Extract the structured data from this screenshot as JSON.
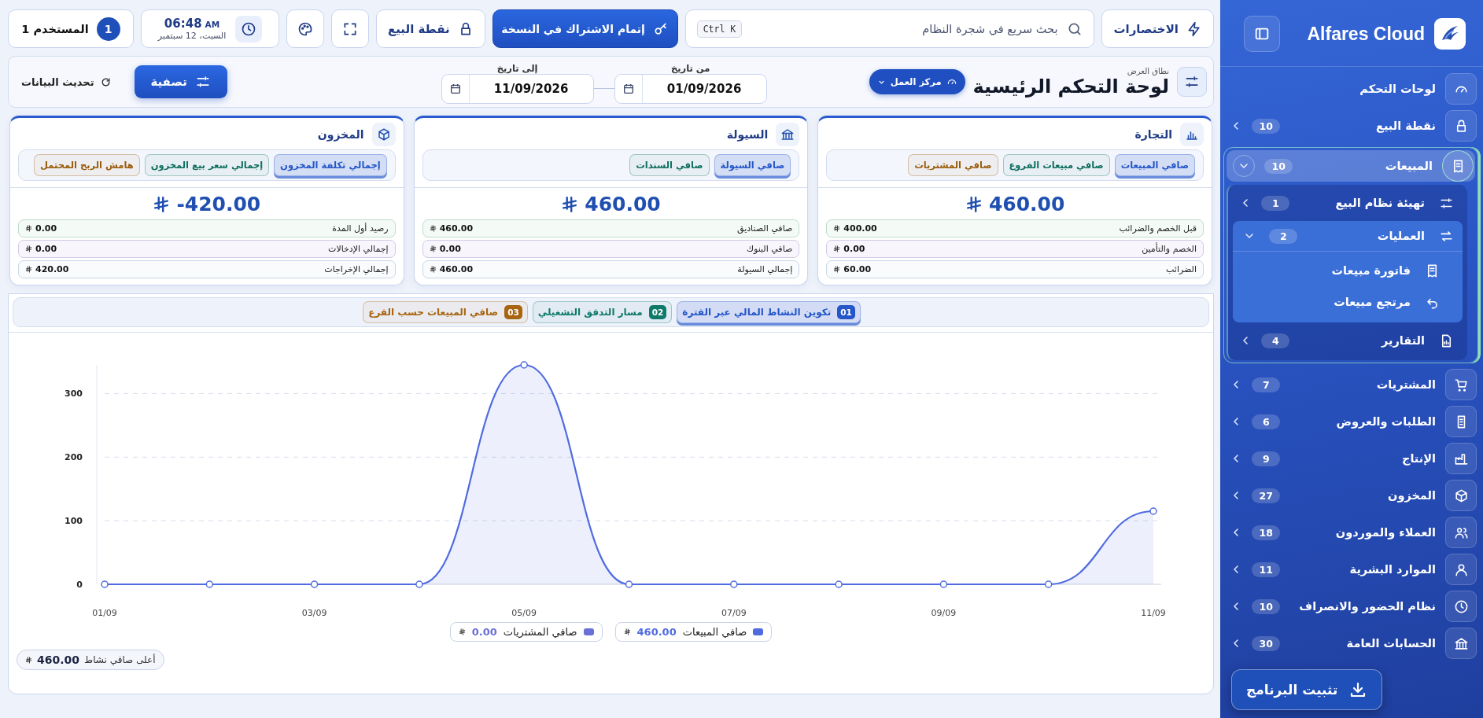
{
  "topbar": {
    "shortcuts": "الاختصارات",
    "search": {
      "placeholder": "بحث سريع في شجرة النظام",
      "shortcut": "Ctrl K"
    },
    "subscribe": "إتمام الاشتراك في النسخة",
    "pos": "نقطة البيع",
    "clock": {
      "time": "06:48",
      "meridiem": "AM",
      "date": "السبت، 12 سبتمبر"
    },
    "user": {
      "name": "المستخدم 1",
      "badge": "1"
    }
  },
  "header": {
    "caption": "نطاق العرض",
    "title": "لوحة التحكم الرئيسية",
    "scope": "مركز العمل",
    "from": {
      "label": "من تاريخ",
      "value": "01/09/2026"
    },
    "to": {
      "label": "إلى تاريخ",
      "value": "11/09/2026"
    },
    "filter": "تصفية",
    "refresh": "تحديث البيانات"
  },
  "cards": [
    {
      "title": "التجارة",
      "tabs": [
        {
          "label": "صافي المبيعات",
          "selected": true,
          "color": "#2456c9"
        },
        {
          "label": "صافي مبيعات الفروع",
          "selected": false,
          "color": "#0f6e5f"
        },
        {
          "label": "صافي المشتريات",
          "selected": false,
          "color": "#9a5c0c"
        }
      ],
      "total": "460.00",
      "rows": [
        {
          "label": "قبل الخصم والضرائب",
          "value": "400.00"
        },
        {
          "label": "الخصم والتأمين",
          "value": "0.00"
        },
        {
          "label": "الضرائب",
          "value": "60.00"
        }
      ]
    },
    {
      "title": "السيولة",
      "tabs": [
        {
          "label": "صافي السيولة",
          "selected": true,
          "color": "#2456c9"
        },
        {
          "label": "صافي السندات",
          "selected": false,
          "color": "#0f6e5f"
        }
      ],
      "total": "460.00",
      "rows": [
        {
          "label": "صافي الصناديق",
          "value": "460.00"
        },
        {
          "label": "صافي البنوك",
          "value": "0.00"
        },
        {
          "label": "إجمالي السيولة",
          "value": "460.00"
        }
      ]
    },
    {
      "title": "المخزون",
      "tabs": [
        {
          "label": "إجمالي تكلفة المخزون",
          "selected": true,
          "color": "#2456c9"
        },
        {
          "label": "إجمالي سعر بيع المخزون",
          "selected": false,
          "color": "#0f6e5f"
        },
        {
          "label": "هامش الربح المحتمل",
          "selected": false,
          "color": "#9a5c0c"
        }
      ],
      "total": "-420.00",
      "rows": [
        {
          "label": "رصيد أول المدة",
          "value": "0.00"
        },
        {
          "label": "إجمالي الإدخالات",
          "value": "0.00"
        },
        {
          "label": "إجمالي الإخراجات",
          "value": "420.00"
        }
      ]
    }
  ],
  "chart_panel": {
    "tabs": [
      {
        "number": "01",
        "label": "تكوين النشاط المالي عبر الفترة",
        "selected": true,
        "color": "#2456c9"
      },
      {
        "number": "02",
        "label": "مسار التدفق التشغيلي",
        "selected": false,
        "color": "#0f7a6a"
      },
      {
        "number": "03",
        "label": "صافي المبيعات حسب الفرع",
        "selected": false,
        "color": "#a8650f"
      }
    ],
    "chart_data": {
      "type": "area",
      "grid": true,
      "ylim": [
        0,
        345
      ],
      "yticks": [
        0,
        100,
        200,
        300
      ],
      "categories": [
        "01/09",
        null,
        "03/09",
        null,
        "05/09",
        null,
        "07/09",
        null,
        "09/09",
        null,
        "11/09"
      ],
      "series": [
        {
          "name": "صافي المبيعات",
          "color": "#4f6be0",
          "values": [
            0,
            0,
            0,
            0,
            345,
            0,
            0,
            0,
            0,
            0,
            115
          ]
        }
      ]
    },
    "legend": [
      {
        "value": "460.00"
      },
      {
        "name": "صافي المشتريات",
        "color": "#6a70d8",
        "value": "0.00"
      }
    ],
    "peak": {
      "label": "أعلى صافي نشاط",
      "value": "460.00"
    }
  },
  "sidebar": {
    "brand": "Alfares Cloud",
    "install": "تثبيت البرنامج",
    "items": [
      {
        "label": "لوحات التحكم",
        "selected": false
      },
      {
        "label": "نقطة البيع",
        "badge": "10",
        "expanded": false,
        "selected": false
      },
      {
        "label": "المبيعات",
        "badge": "10",
        "expanded": true,
        "selected": true,
        "children": [
          {
            "label": "تهيئة نظام البيع",
            "badge": "1",
            "expanded": false,
            "selected": false
          },
          {
            "label": "العمليات",
            "badge": "2",
            "expanded": true,
            "selected": false,
            "children": [
              {
                "label": "فاتورة مبيعات",
                "selected": false
              },
              {
                "label": "مرتجع مبيعات",
                "selected": false
              }
            ]
          },
          {
            "label": "التقارير",
            "badge": "4",
            "expanded": false,
            "selected": false
          }
        ]
      },
      {
        "label": "المشتريات",
        "badge": "7",
        "expanded": false,
        "selected": false
      },
      {
        "label": "الطلبات والعروض",
        "badge": "6",
        "expanded": false,
        "selected": false
      },
      {
        "label": "الإنتاج",
        "badge": "9",
        "expanded": false,
        "selected": false
      },
      {
        "label": "المخزون",
        "badge": "27",
        "expanded": false,
        "selected": false
      },
      {
        "label": "العملاء والموردون",
        "badge": "18",
        "expanded": false,
        "selected": false
      },
      {
        "label": "الموارد البشرية",
        "badge": "11",
        "expanded": false,
        "selected": false
      },
      {
        "label": "نظام الحضور والانصراف",
        "badge": "10",
        "expanded": false,
        "selected": false
      },
      {
        "label": "الحسابات العامة",
        "badge": "30",
        "expanded": false,
        "selected": false
      }
    ]
  }
}
